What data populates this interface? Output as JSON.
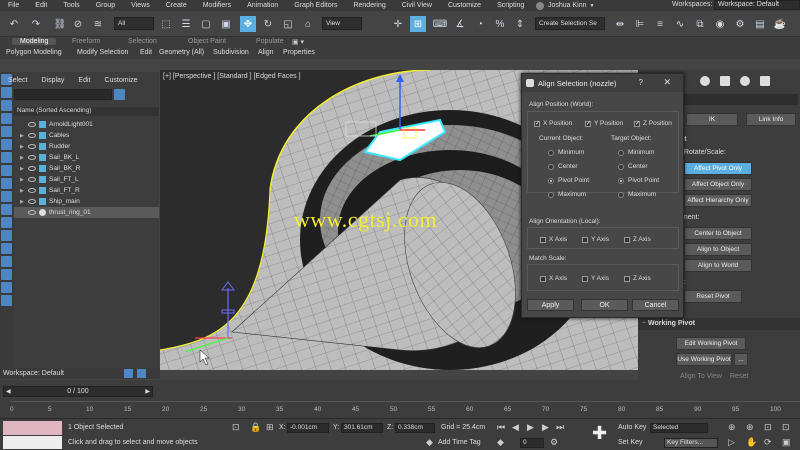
{
  "menubar": {
    "items": [
      "File",
      "Edit",
      "Tools",
      "Group",
      "Views",
      "Create",
      "Modifiers",
      "Animation",
      "Graph Editors",
      "Rendering",
      "Civil View",
      "Customize",
      "Scripting"
    ],
    "user": "Joshua Kinn",
    "workspaces_label": "Workspaces:",
    "workspace_value": "Workspace: Default"
  },
  "toolbar": {
    "filter_value": "All",
    "view_value": "View",
    "selection_set_placeholder": "Create Selection Se"
  },
  "ribbon": {
    "tabs": [
      "Modeling",
      "Freeform",
      "Selection",
      "Object Paint",
      "Populate"
    ],
    "subtabs": [
      "Polygon Modeling",
      "Modify Selection",
      "Edit",
      "Geometry (All)",
      "Subdivision",
      "Align",
      "Properties"
    ]
  },
  "scene_explorer": {
    "menu": [
      "Select",
      "Display",
      "Edit",
      "Customize"
    ],
    "header": "Name (Sorted Ascending)",
    "rows": [
      "ArnoldLight001",
      "Cables",
      "Rudder",
      "Sail_BK_L",
      "Sail_BK_R",
      "Sail_FT_L",
      "Sail_FT_R",
      "Ship_main",
      "thrust_ring_01"
    ],
    "workspace": "Workspace: Default"
  },
  "viewport": {
    "label": "[+] [Perspective ] [Standard ] [Edged Faces ]",
    "watermark": "www.cgtsj.com"
  },
  "dialog": {
    "title": "Align Selection (nozzle)",
    "help": "?",
    "position_group": "Align Position (World):",
    "x_position": "X Position",
    "y_position": "Y Position",
    "z_position": "Z Position",
    "current_object": "Current Object:",
    "target_object": "Target Object:",
    "options": [
      "Minimum",
      "Center",
      "Pivot Point",
      "Maximum"
    ],
    "orientation_group": "Align Orientation (Local):",
    "match_scale_group": "Match Scale:",
    "axes": [
      "X Axis",
      "Y Axis",
      "Z Axis"
    ],
    "apply": "Apply",
    "ok": "OK",
    "cancel": "Cancel"
  },
  "command_panel": {
    "ik_label": "IK",
    "link_info": "Link Info",
    "pivot_label": "ot",
    "move_rotate_scale": "e/Rotate/Scale:",
    "affect_pivot_only": "Affect Pivot Only",
    "affect_object_only": "Affect Object Only",
    "affect_hierarchy_only": "Affect Hierarchy Only",
    "alignment": "nment:",
    "center_to_object": "Center to Object",
    "align_to_object": "Align to Object",
    "align_to_world": "Align to World",
    "pivot_short": "ot:",
    "reset_pivot": "Reset Pivot",
    "working_pivot": "Working Pivot",
    "edit_working_pivot": "Edit Working Pivot",
    "use_working_pivot": "Use Working Pivot",
    "ellipsis": "...",
    "align_to_view": "Align To View",
    "reset": "Reset"
  },
  "timeline": {
    "frame": "0 / 100",
    "ticks": [
      "0",
      "5",
      "10",
      "15",
      "20",
      "25",
      "30",
      "35",
      "40",
      "45",
      "50",
      "55",
      "60",
      "65",
      "70",
      "75",
      "80",
      "85",
      "90",
      "95",
      "100"
    ]
  },
  "status": {
    "selected": "1 Object Selected",
    "prompt": "Click and drag to select and move objects",
    "x_label": "X:",
    "x_value": "-0.001cm",
    "y_label": "Y:",
    "y_value": "301.61cm",
    "z_label": "Z:",
    "z_value": "0.338cm",
    "grid": "Grid = 25.4cm",
    "add_time_tag": "Add Time Tag",
    "auto_key": "Auto Key",
    "set_key": "Set Key",
    "selected_drop": "Selected",
    "key_filters": "Key Filters...",
    "frame_field": "0"
  }
}
